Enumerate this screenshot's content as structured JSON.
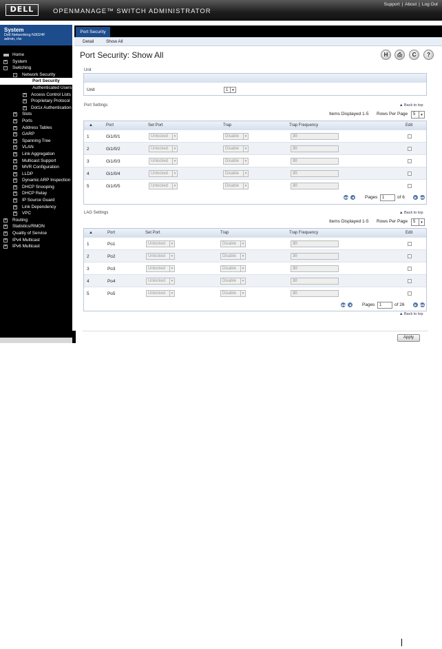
{
  "header": {
    "logo": "DELL",
    "title": "OPENMANAGE™ SWITCH ADMINISTRATOR",
    "links": [
      "Support",
      "About",
      "Log Out"
    ]
  },
  "sidebar": {
    "system_title": "System",
    "device": "Dell Networking N3024F",
    "user": "admin, r/w",
    "tree": [
      {
        "label": "Home",
        "level": 0,
        "icon": "home-icon"
      },
      {
        "label": "System",
        "level": 0,
        "expander": "+"
      },
      {
        "label": "Switching",
        "level": 0,
        "expander": "-"
      },
      {
        "label": "Network Security",
        "level": 1,
        "expander": "-"
      },
      {
        "label": "Port Security",
        "level": 2,
        "selected": true
      },
      {
        "label": "Authenticated Users",
        "level": 2
      },
      {
        "label": "Access Control Lists",
        "level": 2,
        "expander": "+"
      },
      {
        "label": "Proprietary Protocol",
        "level": 2,
        "expander": "+"
      },
      {
        "label": "Dot1x Authentication",
        "level": 2,
        "expander": "+"
      },
      {
        "label": "Slots",
        "level": 1,
        "expander": "+"
      },
      {
        "label": "Ports",
        "level": 1,
        "expander": "+"
      },
      {
        "label": "Address Tables",
        "level": 1,
        "expander": "+"
      },
      {
        "label": "GARP",
        "level": 1,
        "expander": "+"
      },
      {
        "label": "Spanning Tree",
        "level": 1,
        "expander": "+"
      },
      {
        "label": "VLAN",
        "level": 1,
        "expander": "+"
      },
      {
        "label": "Link Aggregation",
        "level": 1,
        "expander": "+"
      },
      {
        "label": "Multicast Support",
        "level": 1,
        "expander": "+"
      },
      {
        "label": "MVR Configuration",
        "level": 1,
        "expander": "+"
      },
      {
        "label": "LLDP",
        "level": 1,
        "expander": "+"
      },
      {
        "label": "Dynamic ARP Inspection",
        "level": 1,
        "expander": "+"
      },
      {
        "label": "DHCP Snooping",
        "level": 1,
        "expander": "+"
      },
      {
        "label": "DHCP Relay",
        "level": 1,
        "expander": "+"
      },
      {
        "label": "IP Source Guard",
        "level": 1,
        "expander": "+"
      },
      {
        "label": "Link Dependency",
        "level": 1,
        "expander": "+"
      },
      {
        "label": "VPC",
        "level": 1,
        "expander": "+"
      },
      {
        "label": "Routing",
        "level": 0,
        "expander": "+"
      },
      {
        "label": "Statistics/RMON",
        "level": 0,
        "expander": "+"
      },
      {
        "label": "Quality of Service",
        "level": 0,
        "expander": "+"
      },
      {
        "label": "IPv4 Multicast",
        "level": 0,
        "expander": "+"
      },
      {
        "label": "IPv6 Multicast",
        "level": 0,
        "expander": "+"
      }
    ]
  },
  "main": {
    "tab": "Port Security",
    "subtabs": [
      "Detail",
      "Show All"
    ],
    "page_title": "Port Security: Show All",
    "toolbar_icons": [
      {
        "name": "save-icon",
        "glyph": "H"
      },
      {
        "name": "print-icon",
        "glyph": "⎙"
      },
      {
        "name": "refresh-icon",
        "glyph": "C"
      },
      {
        "name": "help-icon",
        "glyph": "?"
      }
    ],
    "unit_section": {
      "label": "Unit",
      "field_label": "Unit",
      "value": "1"
    },
    "back_to_top": "Back to top",
    "port_settings": {
      "label": "Port Settings",
      "items_displayed": "Items Displayed 1-5",
      "rows_per_page_label": "Rows Per Page",
      "rows_per_page": "5",
      "columns": [
        "▲",
        "Port",
        "Set Port",
        "Trap",
        "Trap Frequency",
        "Edit"
      ],
      "rows": [
        {
          "num": "1",
          "port": "Gi1/0/1",
          "set_port": "Unlocked",
          "trap": "Disable",
          "freq": "30"
        },
        {
          "num": "2",
          "port": "Gi1/0/2",
          "set_port": "Unlocked",
          "trap": "Disable",
          "freq": "30"
        },
        {
          "num": "3",
          "port": "Gi1/0/3",
          "set_port": "Unlocked",
          "trap": "Disable",
          "freq": "30"
        },
        {
          "num": "4",
          "port": "Gi1/0/4",
          "set_port": "Unlocked",
          "trap": "Disable",
          "freq": "30"
        },
        {
          "num": "5",
          "port": "Gi1/0/5",
          "set_port": "Unlocked",
          "trap": "Disable",
          "freq": "30"
        }
      ],
      "pages_label": "Pages",
      "page": "1",
      "of_label": "of 6"
    },
    "lag_settings": {
      "label": "LAG Settings",
      "items_displayed": "Items Displayed 1-5",
      "rows_per_page_label": "Rows Per Page",
      "rows_per_page": "5",
      "columns": [
        "▲",
        "Port",
        "Set Port",
        "Trap",
        "Trap Frequency",
        "Edit"
      ],
      "rows": [
        {
          "num": "1",
          "port": "Po1",
          "set_port": "Unlocked",
          "trap": "Disable",
          "freq": "30"
        },
        {
          "num": "2",
          "port": "Po2",
          "set_port": "Unlocked",
          "trap": "Disable",
          "freq": "30"
        },
        {
          "num": "3",
          "port": "Po3",
          "set_port": "Unlocked",
          "trap": "Disable",
          "freq": "30"
        },
        {
          "num": "4",
          "port": "Po4",
          "set_port": "Unlocked",
          "trap": "Disable",
          "freq": "30"
        },
        {
          "num": "5",
          "port": "Po5",
          "set_port": "Unlocked",
          "trap": "Disable",
          "freq": "30"
        }
      ],
      "pages_label": "Pages",
      "page": "1",
      "of_label": "of 26"
    },
    "apply_label": "Apply"
  }
}
